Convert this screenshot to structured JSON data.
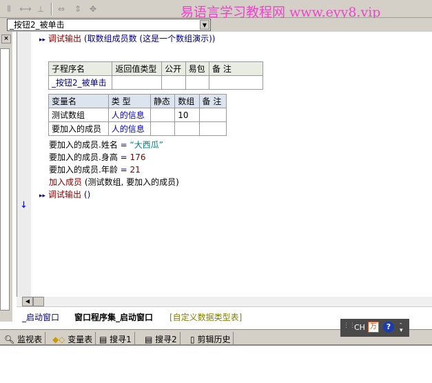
{
  "toolbar": {
    "icons": [
      "align-left-icon",
      "align-h-icon",
      "align-v-icon",
      "same-width-icon",
      "same-height-icon",
      "same-size-icon"
    ],
    "brand": "易语言学习教程网 www.eyy8.vip"
  },
  "combo": {
    "value": "_按钮2_被单击"
  },
  "code": {
    "line1": {
      "cmd": "调试输出",
      "args": "(取数组成员数 (这是一个数组演示))"
    },
    "sub_table": {
      "headers": [
        "子程序名",
        "返回值类型",
        "公开",
        "易包",
        "备 注"
      ],
      "row": [
        "_按钮2_被单击",
        "",
        "",
        "",
        ""
      ]
    },
    "var_table": {
      "headers": [
        "变量名",
        "类 型",
        "静态",
        "数组",
        "备 注"
      ],
      "rows": [
        [
          "测试数组",
          "人的信息",
          "",
          "10",
          ""
        ],
        [
          "要加入的成员",
          "人的信息",
          "",
          "",
          ""
        ]
      ]
    },
    "assign1": {
      "lhs": "要加入的成员.姓名",
      "op": "=",
      "rhs": "“大西瓜”"
    },
    "assign2": {
      "lhs": "要加入的成员.身高",
      "op": "=",
      "rhs": "176"
    },
    "assign3": {
      "lhs": "要加入的成员.年龄",
      "op": "=",
      "rhs": "21"
    },
    "call": {
      "cmd": "加入成员",
      "args": "(测试数组, 要加入的成员)"
    },
    "last": {
      "cmd": "调试输出",
      "args": "()"
    }
  },
  "tabs": [
    "_启动窗口",
    "窗口程序集_启动窗口",
    "[自定义数据类型表]"
  ],
  "ime": {
    "label": "CH"
  },
  "bottom_tabs": [
    "监视表",
    "变量表",
    "搜寻1",
    "搜寻2",
    "剪辑历史"
  ]
}
